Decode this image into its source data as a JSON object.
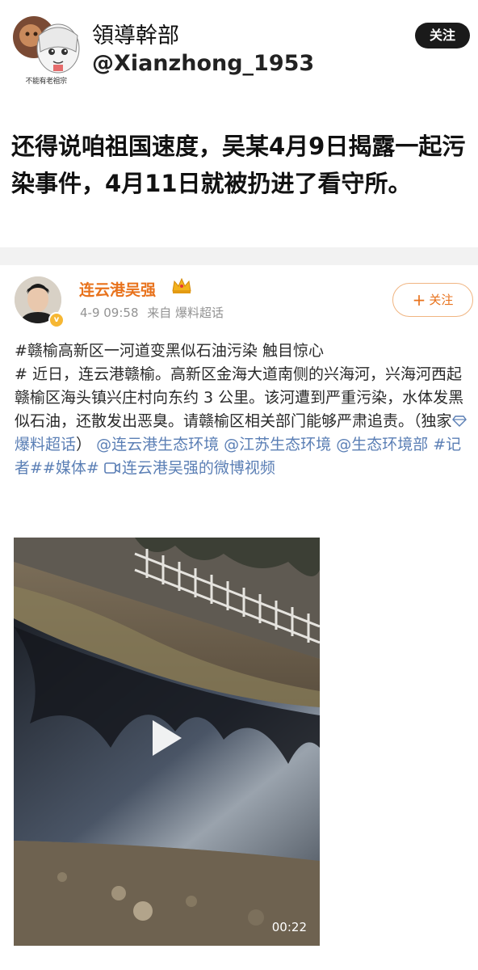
{
  "post": {
    "avatar_caption": "不能有老祖宗",
    "display_name": "領導幹部",
    "handle": "@Xianzhong_1953",
    "follow_label": "关注",
    "text": "还得说咱祖国速度，吴某4月9日揭露一起污染事件，4月11日就被扔进了看守所。"
  },
  "weibo": {
    "author": "连云港吴强",
    "time": "4-9 09:58",
    "source": "来自 爆料超话",
    "follow_label": "关注",
    "body": {
      "p1": "#赣榆高新区一河道变黑似石油污染 触目惊心",
      "p2": "# 近日，连云港赣榆。高新区金海大道南侧的兴海河，兴海河西起赣榆区海头镇兴庄村向东约 3 公里。该河遭到严重污染，水体发黑似石油，还散发出恶臭。请赣榆区相关部门能够严肃追责。（独家",
      "topic_link": "爆料超话",
      "p3": "）",
      "mention1": "@连云港生态环境",
      "mention2": "@江苏生态环境",
      "mention3": "@生态环境部",
      "tags": "#记者##媒体#",
      "video_link": "连云港吴强的微博视频"
    },
    "video": {
      "duration": "00:22"
    }
  },
  "colors": {
    "weibo_orange": "#e8721c",
    "link_blue": "#5b7fb5",
    "follow_dark": "#1a1a1a"
  },
  "icons": [
    "avatar-cartoon-icon",
    "crown-icon",
    "verified-icon",
    "plus-icon",
    "diamond-icon",
    "video-icon",
    "play-icon"
  ]
}
